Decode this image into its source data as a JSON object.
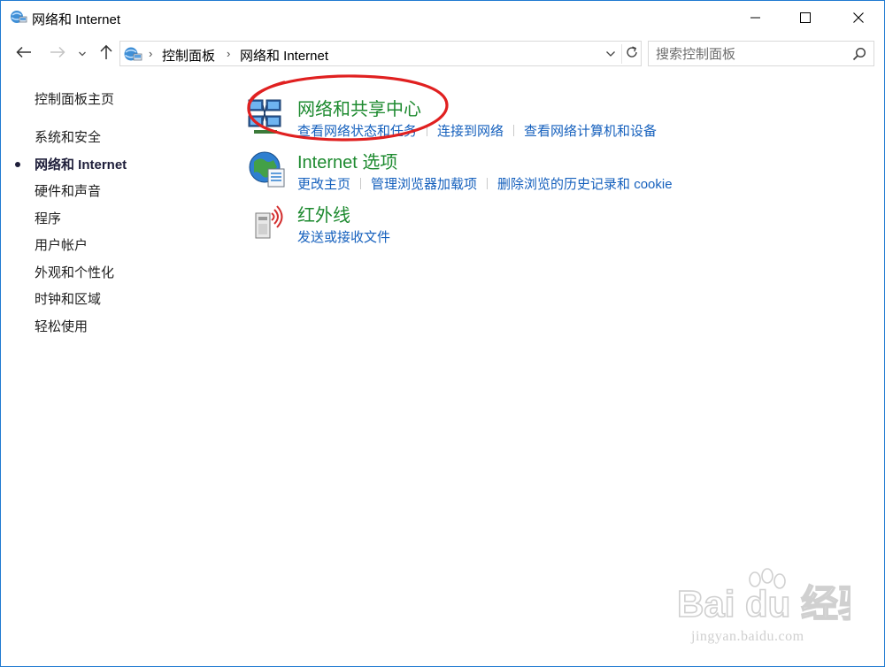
{
  "window": {
    "title": "网络和 Internet"
  },
  "address": {
    "crumbs": [
      "控制面板",
      "网络和 Internet"
    ]
  },
  "search": {
    "placeholder": "搜索控制面板"
  },
  "left_nav": {
    "home": "控制面板主页",
    "items": [
      "系统和安全",
      "网络和 Internet",
      "硬件和声音",
      "程序",
      "用户帐户",
      "外观和个性化",
      "时钟和区域",
      "轻松使用"
    ],
    "active_index": 1
  },
  "categories": [
    {
      "title": "网络和共享中心",
      "icon": "network-sharing-icon",
      "links": [
        "查看网络状态和任务",
        "连接到网络",
        "查看网络计算机和设备"
      ]
    },
    {
      "title": "Internet 选项",
      "icon": "internet-options-icon",
      "links": [
        "更改主页",
        "管理浏览器加载项",
        "删除浏览的历史记录和 cookie"
      ]
    },
    {
      "title": "红外线",
      "icon": "infrared-icon",
      "links": [
        "发送或接收文件"
      ]
    }
  ],
  "annotation": {
    "highlight_color": "#e02020"
  },
  "watermark": {
    "brand": "Bai du 经验",
    "url": "jingyan.baidu.com"
  },
  "colors": {
    "category_title": "#1d8a2f",
    "link": "#1560bd",
    "window_border": "#1f7ad1"
  }
}
